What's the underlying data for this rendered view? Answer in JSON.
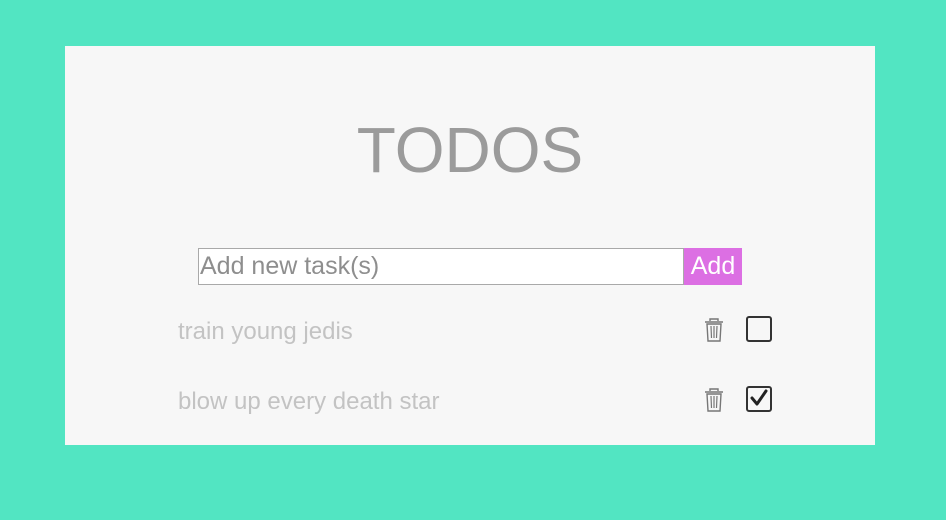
{
  "app": {
    "title": "TODOS"
  },
  "add_form": {
    "placeholder": "Add new task(s)",
    "value": "",
    "button_label": "Add"
  },
  "todos": [
    {
      "text": "train young jedis",
      "completed": false
    },
    {
      "text": "blow up every death star",
      "completed": true
    }
  ],
  "icons": {
    "delete": "trash-icon",
    "unchecked": "checkbox-empty-icon",
    "checked": "checkbox-checked-icon"
  },
  "colors": {
    "background": "#52e5c2",
    "card": "#f7f7f7",
    "title": "#9b9b9b",
    "add_button": "#dc6fe3",
    "todo_text": "#c3c3c3"
  }
}
